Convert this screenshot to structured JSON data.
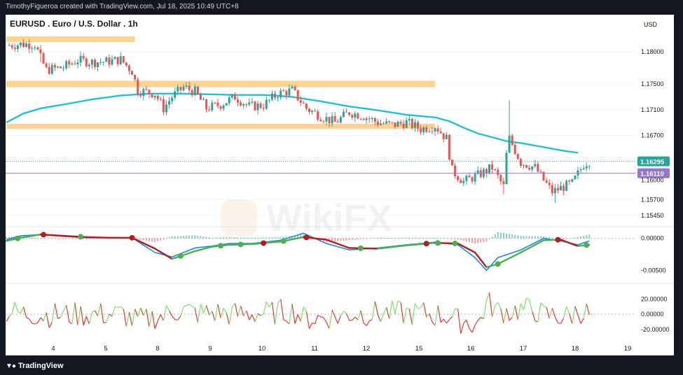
{
  "header": {
    "attribution": "TimothyFigueroa created with TradingView.com, Jul 18, 2025 10:49 UTC+8"
  },
  "footer": {
    "brand": "TradingView",
    "brand_icon": "tradingview-logo-icon"
  },
  "watermark": "WikiFX",
  "colors": {
    "up_candle": "#26a69a",
    "down_candle": "#ef5350",
    "ma_line": "#26bfcf",
    "zone": "#ffcc80",
    "macd_line": "#1e88e5",
    "signal_line": "#b71c1c",
    "signal_line_alt": "#4caf50",
    "osc_up": "#7de26b",
    "osc_down": "#e53935",
    "current_price": "#26a69a",
    "level_line": "#9575cd"
  },
  "chart_data": [
    {
      "type": "candlestick",
      "title": "EURUSD . Euro / U.S. Dollar . 1h",
      "currency": "USD",
      "ylim": [
        1.153,
        1.1835
      ],
      "y_ticks": [
        "1.18000",
        "1.17500",
        "1.17100",
        "1.16700",
        "1.16000",
        "1.15700",
        "1.15450"
      ],
      "x_tick_labels": [
        "4",
        "5",
        "8",
        "9",
        "10",
        "11",
        "12",
        "15",
        "16",
        "17",
        "18",
        "19"
      ],
      "current_price_label": "1.16295",
      "current_price": 1.16295,
      "level_label": "1.16110",
      "level_price": 1.1611,
      "resistance_zones": [
        {
          "from_index": 0,
          "to_index": 45,
          "low": 1.1815,
          "high": 1.1824
        },
        {
          "from_index": 0,
          "to_index": 150,
          "low": 1.1745,
          "high": 1.1755
        },
        {
          "from_index": 0,
          "to_index": 150,
          "low": 1.168,
          "high": 1.1688
        }
      ],
      "moving_average": [
        [
          0,
          1.169
        ],
        [
          6,
          1.1704
        ],
        [
          12,
          1.1712
        ],
        [
          20,
          1.1718
        ],
        [
          30,
          1.1726
        ],
        [
          40,
          1.1732
        ],
        [
          50,
          1.1735
        ],
        [
          60,
          1.1735
        ],
        [
          70,
          1.1734
        ],
        [
          80,
          1.1733
        ],
        [
          90,
          1.1733
        ],
        [
          100,
          1.173
        ],
        [
          110,
          1.1723
        ],
        [
          120,
          1.1715
        ],
        [
          130,
          1.1709
        ],
        [
          140,
          1.1702
        ],
        [
          150,
          1.1698
        ],
        [
          155,
          1.1692
        ],
        [
          160,
          1.1682
        ],
        [
          165,
          1.1673
        ],
        [
          170,
          1.1667
        ],
        [
          175,
          1.1661
        ],
        [
          180,
          1.1658
        ],
        [
          190,
          1.165
        ],
        [
          195,
          1.1646
        ],
        [
          200,
          1.1643
        ]
      ],
      "close_path": [
        [
          0,
          1.181
        ],
        [
          5,
          1.1812
        ],
        [
          10,
          1.1812
        ],
        [
          12,
          1.179
        ],
        [
          14,
          1.1772
        ],
        [
          20,
          1.1776
        ],
        [
          25,
          1.1787
        ],
        [
          30,
          1.1784
        ],
        [
          35,
          1.1785
        ],
        [
          40,
          1.1788
        ],
        [
          44,
          1.177
        ],
        [
          46,
          1.174
        ],
        [
          52,
          1.1735
        ],
        [
          55,
          1.1712
        ],
        [
          58,
          1.173
        ],
        [
          62,
          1.1745
        ],
        [
          66,
          1.1738
        ],
        [
          70,
          1.1712
        ],
        [
          75,
          1.1718
        ],
        [
          80,
          1.173
        ],
        [
          85,
          1.1715
        ],
        [
          90,
          1.1717
        ],
        [
          95,
          1.1735
        ],
        [
          100,
          1.174
        ],
        [
          105,
          1.1712
        ],
        [
          110,
          1.17
        ],
        [
          115,
          1.169
        ],
        [
          120,
          1.1706
        ],
        [
          125,
          1.17
        ],
        [
          130,
          1.169
        ],
        [
          135,
          1.1686
        ],
        [
          140,
          1.169
        ],
        [
          145,
          1.168
        ],
        [
          150,
          1.1685
        ],
        [
          154,
          1.1665
        ],
        [
          156,
          1.1615
        ],
        [
          160,
          1.1598
        ],
        [
          165,
          1.1608
        ],
        [
          170,
          1.162
        ],
        [
          172,
          1.1605
        ],
        [
          174,
          1.159
        ],
        [
          175,
          1.164
        ],
        [
          176,
          1.1665
        ],
        [
          180,
          1.1628
        ],
        [
          185,
          1.162
        ],
        [
          188,
          1.16
        ],
        [
          191,
          1.1582
        ],
        [
          195,
          1.159
        ],
        [
          198,
          1.1595
        ],
        [
          202,
          1.1625
        ],
        [
          204,
          1.163
        ]
      ]
    },
    {
      "type": "macd",
      "y_ticks": [
        "0.00000",
        "-0.00500"
      ],
      "ylim": [
        -0.0068,
        0.0015
      ],
      "macd": [
        [
          0,
          -0.0002
        ],
        [
          5,
          0.0004
        ],
        [
          12,
          0.0006
        ],
        [
          20,
          0.0003
        ],
        [
          28,
          0.0001
        ],
        [
          36,
          0.0001
        ],
        [
          44,
          0.0001
        ],
        [
          52,
          -0.0022
        ],
        [
          58,
          -0.0029
        ],
        [
          66,
          -0.0015
        ],
        [
          72,
          -0.0012
        ],
        [
          78,
          -0.0008
        ],
        [
          86,
          -0.0008
        ],
        [
          96,
          -0.0003
        ],
        [
          104,
          0.0008
        ],
        [
          112,
          -0.0008
        ],
        [
          120,
          -0.0018
        ],
        [
          130,
          -0.0015
        ],
        [
          140,
          -0.001
        ],
        [
          150,
          -0.0006
        ],
        [
          158,
          -0.001
        ],
        [
          164,
          -0.003
        ],
        [
          168,
          -0.005
        ],
        [
          172,
          -0.003
        ],
        [
          180,
          -0.0018
        ],
        [
          188,
          0.0
        ],
        [
          194,
          -0.0004
        ],
        [
          200,
          -0.001
        ],
        [
          204,
          -0.0004
        ]
      ],
      "signal": [
        [
          0,
          -0.0004
        ],
        [
          5,
          0.0001
        ],
        [
          12,
          0.0006
        ],
        [
          20,
          0.0004
        ],
        [
          28,
          0.0002
        ],
        [
          36,
          0.0001
        ],
        [
          44,
          0.0001
        ],
        [
          52,
          -0.0016
        ],
        [
          58,
          -0.0032
        ],
        [
          66,
          -0.002
        ],
        [
          72,
          -0.0013
        ],
        [
          78,
          -0.001
        ],
        [
          86,
          -0.0009
        ],
        [
          96,
          -0.0005
        ],
        [
          104,
          0.0002
        ],
        [
          112,
          -0.0002
        ],
        [
          120,
          -0.0015
        ],
        [
          130,
          -0.0016
        ],
        [
          140,
          -0.0011
        ],
        [
          150,
          -0.0007
        ],
        [
          158,
          -0.0008
        ],
        [
          164,
          -0.0022
        ],
        [
          168,
          -0.0045
        ],
        [
          172,
          -0.004
        ],
        [
          180,
          -0.0022
        ],
        [
          188,
          -0.0003
        ],
        [
          194,
          -0.0002
        ],
        [
          200,
          -0.0012
        ],
        [
          204,
          -0.001
        ]
      ],
      "cross_markers": [
        {
          "index": 4,
          "side": "up"
        },
        {
          "index": 13,
          "side": "down"
        },
        {
          "index": 26,
          "side": "up"
        },
        {
          "index": 44,
          "side": "down"
        },
        {
          "index": 61,
          "side": "up"
        },
        {
          "index": 75,
          "side": "up"
        },
        {
          "index": 82,
          "side": "up"
        },
        {
          "index": 90,
          "side": "down"
        },
        {
          "index": 97,
          "side": "up"
        },
        {
          "index": 105,
          "side": "down"
        },
        {
          "index": 124,
          "side": "up"
        },
        {
          "index": 147,
          "side": "down"
        },
        {
          "index": 151,
          "side": "up"
        },
        {
          "index": 157,
          "side": "up"
        },
        {
          "index": 172,
          "side": "up"
        },
        {
          "index": 193,
          "side": "down"
        },
        {
          "index": 203,
          "side": "up"
        }
      ]
    },
    {
      "type": "oscillator",
      "y_ticks": [
        "20.00000",
        "0.00000",
        "-20.00000"
      ],
      "ylim": [
        -34,
        38
      ]
    }
  ]
}
